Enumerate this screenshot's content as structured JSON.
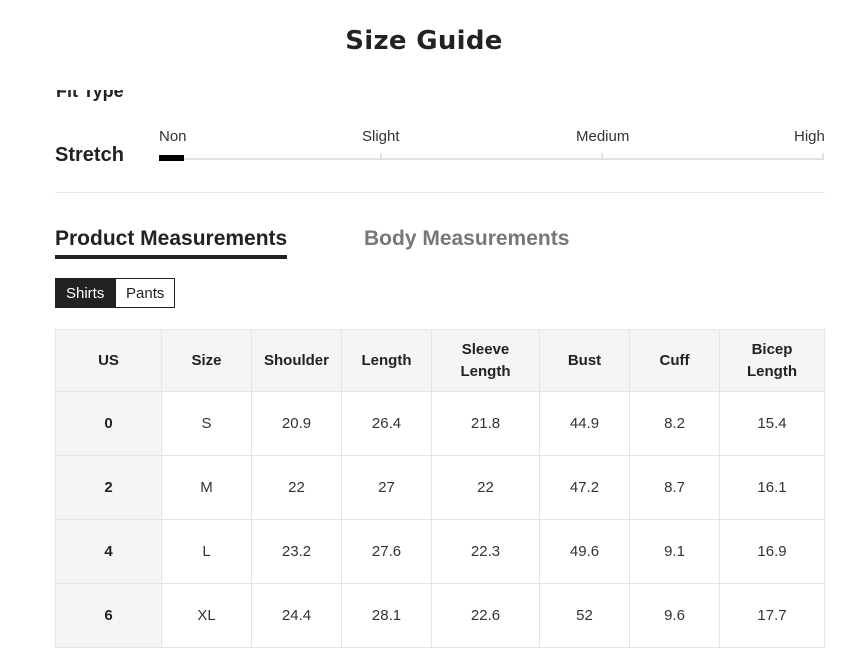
{
  "page": {
    "title": "Size Guide",
    "clipped_heading": "Fit Type"
  },
  "stretch": {
    "label": "Stretch",
    "levels": [
      "Non",
      "Slight",
      "Medium",
      "High"
    ],
    "selected_level": "Non"
  },
  "tabs": {
    "active": "Product Measurements",
    "inactive": "Body Measurements"
  },
  "category_toggle": {
    "options": [
      "Shirts",
      "Pants"
    ],
    "selected": "Shirts"
  },
  "table": {
    "headers": [
      "US",
      "Size",
      "Shoulder",
      "Length",
      "Sleeve\nLength",
      "Bust",
      "Cuff",
      "Bicep\nLength"
    ],
    "rows": [
      [
        "0",
        "S",
        "20.9",
        "26.4",
        "21.8",
        "44.9",
        "8.2",
        "15.4"
      ],
      [
        "2",
        "M",
        "22",
        "27",
        "22",
        "47.2",
        "8.7",
        "16.1"
      ],
      [
        "4",
        "L",
        "23.2",
        "27.6",
        "22.3",
        "49.6",
        "9.1",
        "16.9"
      ],
      [
        "6",
        "XL",
        "24.4",
        "28.1",
        "22.6",
        "52",
        "9.6",
        "17.7"
      ]
    ]
  }
}
